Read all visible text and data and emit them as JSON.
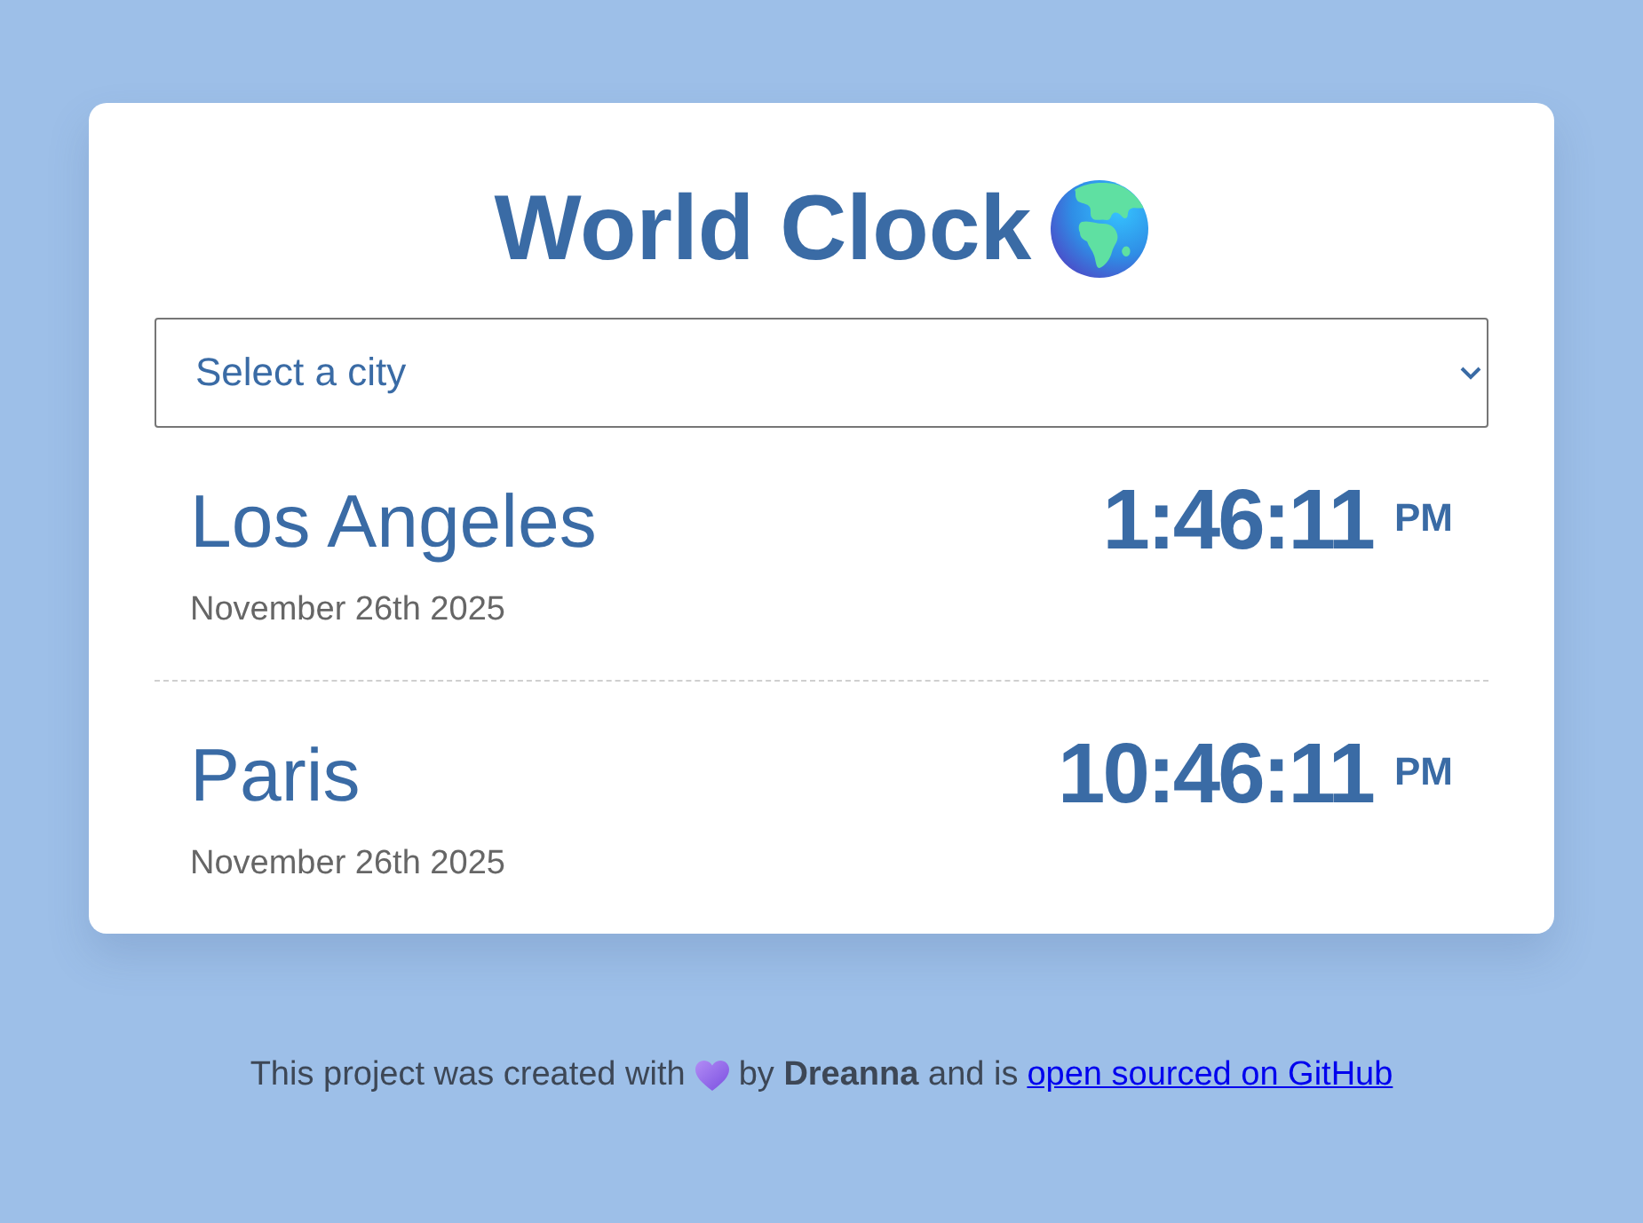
{
  "title": "World Clock",
  "city_select": {
    "placeholder": "Select a city"
  },
  "cities": [
    {
      "name": "Los Angeles",
      "date": "November 26th 2025",
      "time": "1:46:11",
      "period": "PM"
    },
    {
      "name": "Paris",
      "date": "November 26th 2025",
      "time": "10:46:11",
      "period": "PM"
    }
  ],
  "footer": {
    "text_before": "This project was created with",
    "text_after": "by **Dreanna** and is",
    "link": "open sourced on GitHub"
  }
}
